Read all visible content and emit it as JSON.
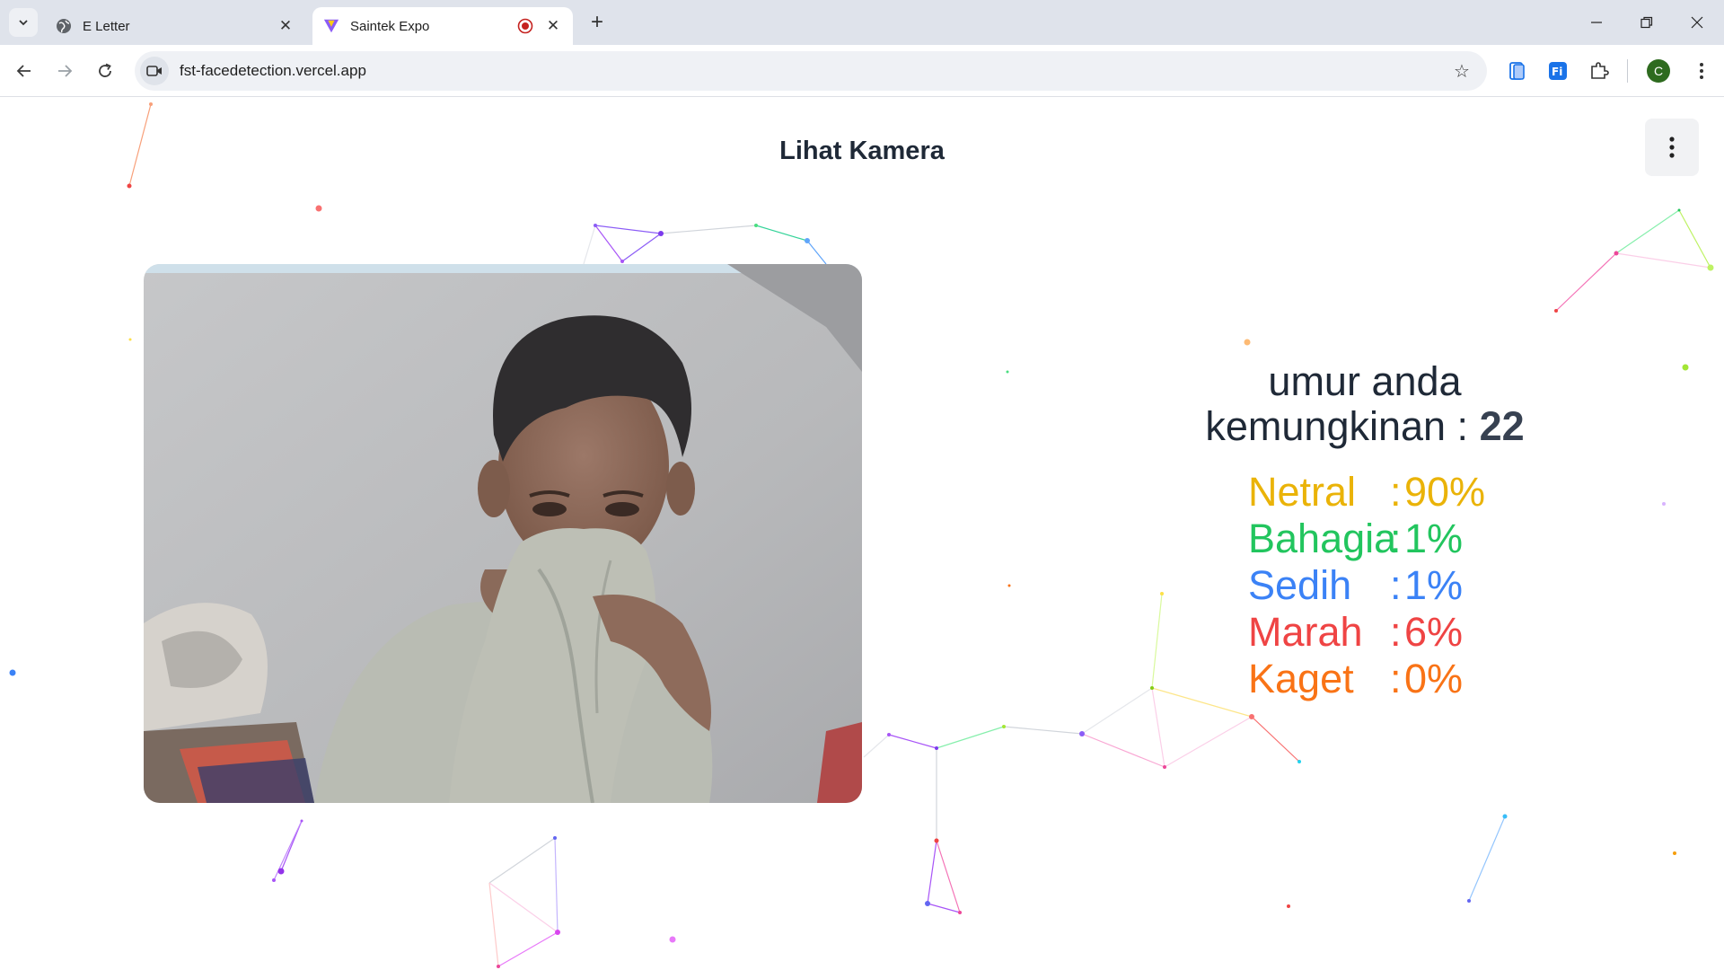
{
  "browser": {
    "tabs": [
      {
        "title": "E Letter",
        "active": false
      },
      {
        "title": "Saintek Expo",
        "active": true
      }
    ],
    "url": "fst-facedetection.vercel.app",
    "profile_initial": "C"
  },
  "page": {
    "title": "Lihat Kamera",
    "age_label_1": "umur anda",
    "age_label_2": "kemungkinan : ",
    "age_value": "22",
    "emotions": [
      {
        "name": "Netral",
        "value": "90%",
        "color": "#eab308"
      },
      {
        "name": "Bahagia",
        "value": "1%",
        "color": "#22c55e"
      },
      {
        "name": "Sedih",
        "value": "1%",
        "color": "#3b82f6"
      },
      {
        "name": "Marah",
        "value": "6%",
        "color": "#ef4444"
      },
      {
        "name": "Kaget",
        "value": "0%",
        "color": "#f97316"
      }
    ]
  },
  "icons": {
    "tab_favicon_1": "globe-icon",
    "tab_favicon_2": "vite-logo-icon",
    "recording": "recording-icon",
    "site": "camera-icon"
  }
}
